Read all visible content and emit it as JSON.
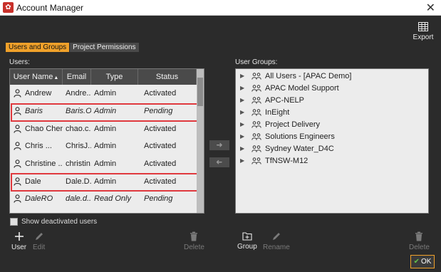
{
  "window": {
    "title": "Account Manager",
    "app_icon": "account-manager-logo-icon",
    "close_icon": "close-icon"
  },
  "toolbar": {
    "export_label": "Export",
    "export_icon": "table-grid-icon"
  },
  "tabs": [
    {
      "label": "Users and Groups",
      "active": true
    },
    {
      "label": "Project Permissions",
      "active": false
    }
  ],
  "users": {
    "section_label": "Users:",
    "columns": [
      "User Name",
      "Email",
      "Type",
      "Status"
    ],
    "sort_indicator": "▲",
    "rows": [
      {
        "name": "Andrew",
        "email": "Andre...",
        "type": "Admin",
        "status": "Activated",
        "italic": false,
        "highlighted": false
      },
      {
        "name": "Baris",
        "email": "Baris.O...",
        "type": "Admin",
        "status": "Pending",
        "italic": true,
        "highlighted": true
      },
      {
        "name": "Chao Chen",
        "email": "chao.c...",
        "type": "Admin",
        "status": "Activated",
        "italic": false,
        "highlighted": false
      },
      {
        "name": "Chris ...",
        "email": "ChrisJ...",
        "type": "Admin",
        "status": "Activated",
        "italic": false,
        "highlighted": false
      },
      {
        "name": "Christine ...",
        "email": "christin...",
        "type": "Admin",
        "status": "Activated",
        "italic": false,
        "highlighted": false
      },
      {
        "name": "Dale",
        "email": "Dale.D...",
        "type": "Admin",
        "status": "Activated",
        "italic": false,
        "highlighted": true
      },
      {
        "name": "DaleRO",
        "email": "dale.d...",
        "type": "Read Only",
        "status": "Pending",
        "italic": true,
        "highlighted": false
      }
    ],
    "show_deactivated_label": "Show deactivated users",
    "actions": {
      "user": "User",
      "edit": "Edit",
      "delete": "Delete"
    },
    "highlight_color": "#e0393e"
  },
  "move_buttons": {
    "add_icon": "arrow-right-icon",
    "remove_icon": "arrow-left-icon"
  },
  "groups": {
    "section_label": "User Groups:",
    "items": [
      "All Users - [APAC Demo]",
      "APAC Model Support",
      "APC-NELP",
      "InEight",
      "Project Delivery",
      "Solutions Engineers",
      "Sydney Water_D4C",
      "TfNSW-M12"
    ],
    "actions": {
      "group": "Group",
      "rename": "Rename",
      "delete": "Delete"
    }
  },
  "footer": {
    "ok_label": "OK"
  },
  "colors": {
    "accent": "#f0a12a",
    "background": "#2b2b2b",
    "panel": "#ececec",
    "ok_check": "#63c24a"
  }
}
